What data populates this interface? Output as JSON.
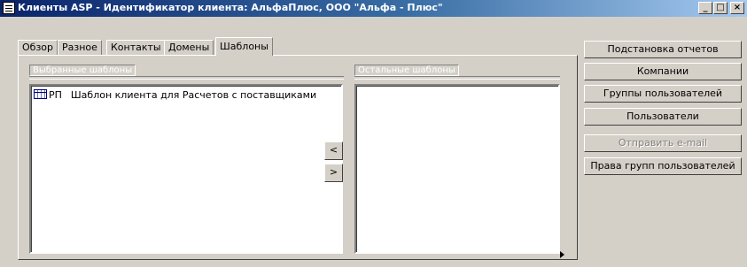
{
  "window": {
    "title": "Клиенты ASP - Идентификатор клиента: АльфаПлюс, ООО \"Альфа - Плюс\"",
    "minimize_glyph": "_",
    "maximize_glyph": "□",
    "close_glyph": "×"
  },
  "tabs": [
    {
      "label": "Обзор"
    },
    {
      "label": "Разное"
    },
    {
      "label": "Контакты"
    },
    {
      "label": "Домены"
    },
    {
      "label": "Шаблоны",
      "active": true
    }
  ],
  "templates": {
    "selected_label": "Выбранные шаблоны",
    "other_label": "Остальные шаблоны",
    "selected_items": [
      {
        "code": "РП",
        "name": "Шаблон клиента для Расчетов с поставщиками",
        "icon": "table-icon"
      }
    ],
    "other_items": [],
    "move_left_glyph": "<",
    "move_right_glyph": ">"
  },
  "side_buttons": [
    {
      "label": "Подстановка отчетов",
      "enabled": true
    },
    {
      "label": "Компании",
      "enabled": true
    },
    {
      "label": "Группы пользователей",
      "enabled": true
    },
    {
      "label": "Пользователи",
      "enabled": true
    },
    {
      "label": "Отправить e-mail",
      "enabled": false
    },
    {
      "label": "Права групп пользователей",
      "enabled": true
    }
  ]
}
